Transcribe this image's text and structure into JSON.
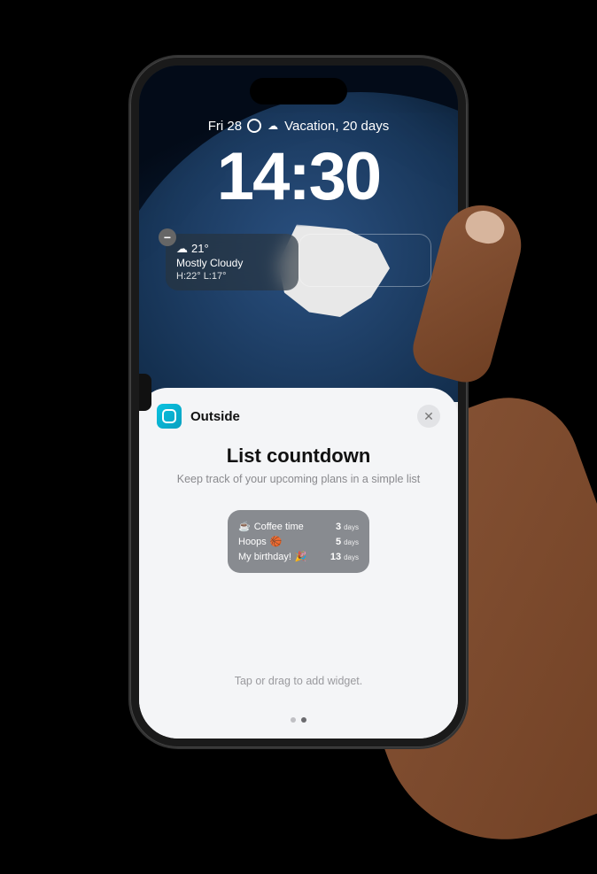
{
  "lockscreen": {
    "date": "Fri 28",
    "event": "Vacation, 20 days",
    "time": "14:30"
  },
  "weather": {
    "temp": "21°",
    "condition": "Mostly Cloudy",
    "high_low": "H:22° L:17°"
  },
  "sheet": {
    "app_name": "Outside",
    "title": "List countdown",
    "subtitle": "Keep track of your upcoming plans in a simple list",
    "instruction": "Tap or drag to add widget."
  },
  "preview_items": [
    {
      "icon": "☕",
      "label": "Coffee time",
      "count": "3",
      "unit": "days"
    },
    {
      "icon": "🏀",
      "label": "Hoops",
      "count": "5",
      "unit": "days"
    },
    {
      "icon": "🎉",
      "label": "My birthday!",
      "count": "13",
      "unit": "days"
    }
  ],
  "page_index": 1,
  "page_count": 2
}
